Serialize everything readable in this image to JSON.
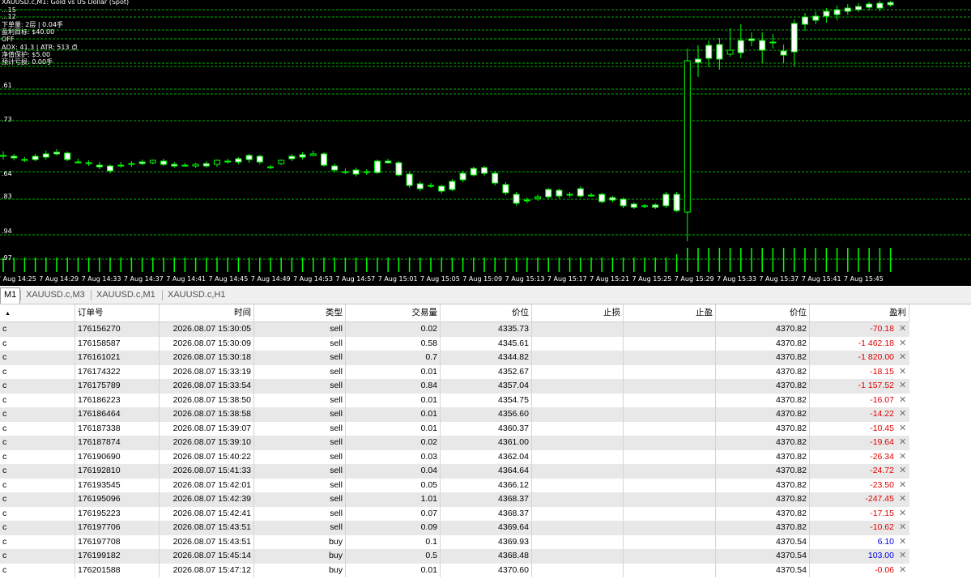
{
  "window_title": "XAUUSD.c,M1: Gold vs US Dollar (Spot)",
  "indicator_lines": [
    "XAUUSD.c,M1: Gold vs US Dollar (Spot)",
    "...15",
    "...12",
    "下单量: 2层 | 0.04手",
    "盈利目标: $40.00",
    "OFF",
    "ADX: 41.3 | ATR: 513 点",
    "净值保护: $5.00",
    "预计亏损: 0.00手"
  ],
  "price_labels": [
    ".61",
    ".73",
    ".64",
    ".83",
    ".94",
    ".97"
  ],
  "time_labels": [
    "7 Aug 14:25",
    "7 Aug 14:29",
    "7 Aug 14:33",
    "7 Aug 14:37",
    "7 Aug 14:41",
    "7 Aug 14:45",
    "7 Aug 14:49",
    "7 Aug 14:53",
    "7 Aug 14:57",
    "7 Aug 15:01",
    "7 Aug 15:05",
    "7 Aug 15:09",
    "7 Aug 15:13",
    "7 Aug 15:17",
    "7 Aug 15:21",
    "7 Aug 15:25",
    "7 Aug 15:29",
    "7 Aug 15:33",
    "7 Aug 15:37",
    "7 Aug 15:41",
    "7 Aug 15:45"
  ],
  "colors": {
    "bull": "#00ff00",
    "bear_body": "#ffffff",
    "grid": "#00b000",
    "background": "#000000",
    "loss": "#e00000",
    "profit": "#0000e0"
  },
  "tabs": [
    {
      "label": "M1",
      "active": true
    },
    {
      "label": "XAUUSD.c,M3",
      "active": false
    },
    {
      "label": "XAUUSD.c,M1",
      "active": false
    },
    {
      "label": "XAUUSD.c,H1",
      "active": false
    }
  ],
  "table": {
    "columns": [
      "",
      "订单号",
      "时间",
      "类型",
      "交易量",
      "价位",
      "止损",
      "止盈",
      "价位",
      "盈利"
    ],
    "rows": [
      {
        "sym": "c",
        "ticket": "176156270",
        "time": "2026.08.07 15:30:05",
        "type": "sell",
        "volume": "0.02",
        "open": "4335.73",
        "sl": "",
        "tp": "",
        "price": "4370.82",
        "profit": "-70.18"
      },
      {
        "sym": "c",
        "ticket": "176158587",
        "time": "2026.08.07 15:30:09",
        "type": "sell",
        "volume": "0.58",
        "open": "4345.61",
        "sl": "",
        "tp": "",
        "price": "4370.82",
        "profit": "-1 462.18"
      },
      {
        "sym": "c",
        "ticket": "176161021",
        "time": "2026.08.07 15:30:18",
        "type": "sell",
        "volume": "0.7",
        "open": "4344.82",
        "sl": "",
        "tp": "",
        "price": "4370.82",
        "profit": "-1 820.00"
      },
      {
        "sym": "c",
        "ticket": "176174322",
        "time": "2026.08.07 15:33:19",
        "type": "sell",
        "volume": "0.01",
        "open": "4352.67",
        "sl": "",
        "tp": "",
        "price": "4370.82",
        "profit": "-18.15"
      },
      {
        "sym": "c",
        "ticket": "176175789",
        "time": "2026.08.07 15:33:54",
        "type": "sell",
        "volume": "0.84",
        "open": "4357.04",
        "sl": "",
        "tp": "",
        "price": "4370.82",
        "profit": "-1 157.52"
      },
      {
        "sym": "c",
        "ticket": "176186223",
        "time": "2026.08.07 15:38:50",
        "type": "sell",
        "volume": "0.01",
        "open": "4354.75",
        "sl": "",
        "tp": "",
        "price": "4370.82",
        "profit": "-16.07"
      },
      {
        "sym": "c",
        "ticket": "176186464",
        "time": "2026.08.07 15:38:58",
        "type": "sell",
        "volume": "0.01",
        "open": "4356.60",
        "sl": "",
        "tp": "",
        "price": "4370.82",
        "profit": "-14.22"
      },
      {
        "sym": "c",
        "ticket": "176187338",
        "time": "2026.08.07 15:39:07",
        "type": "sell",
        "volume": "0.01",
        "open": "4360.37",
        "sl": "",
        "tp": "",
        "price": "4370.82",
        "profit": "-10.45"
      },
      {
        "sym": "c",
        "ticket": "176187874",
        "time": "2026.08.07 15:39:10",
        "type": "sell",
        "volume": "0.02",
        "open": "4361.00",
        "sl": "",
        "tp": "",
        "price": "4370.82",
        "profit": "-19.64"
      },
      {
        "sym": "c",
        "ticket": "176190690",
        "time": "2026.08.07 15:40:22",
        "type": "sell",
        "volume": "0.03",
        "open": "4362.04",
        "sl": "",
        "tp": "",
        "price": "4370.82",
        "profit": "-26.34"
      },
      {
        "sym": "c",
        "ticket": "176192810",
        "time": "2026.08.07 15:41:33",
        "type": "sell",
        "volume": "0.04",
        "open": "4364.64",
        "sl": "",
        "tp": "",
        "price": "4370.82",
        "profit": "-24.72"
      },
      {
        "sym": "c",
        "ticket": "176193545",
        "time": "2026.08.07 15:42:01",
        "type": "sell",
        "volume": "0.05",
        "open": "4366.12",
        "sl": "",
        "tp": "",
        "price": "4370.82",
        "profit": "-23.50"
      },
      {
        "sym": "c",
        "ticket": "176195096",
        "time": "2026.08.07 15:42:39",
        "type": "sell",
        "volume": "1.01",
        "open": "4368.37",
        "sl": "",
        "tp": "",
        "price": "4370.82",
        "profit": "-247.45"
      },
      {
        "sym": "c",
        "ticket": "176195223",
        "time": "2026.08.07 15:42:41",
        "type": "sell",
        "volume": "0.07",
        "open": "4368.37",
        "sl": "",
        "tp": "",
        "price": "4370.82",
        "profit": "-17.15"
      },
      {
        "sym": "c",
        "ticket": "176197706",
        "time": "2026.08.07 15:43:51",
        "type": "sell",
        "volume": "0.09",
        "open": "4369.64",
        "sl": "",
        "tp": "",
        "price": "4370.82",
        "profit": "-10.62"
      },
      {
        "sym": "c",
        "ticket": "176197708",
        "time": "2026.08.07 15:43:51",
        "type": "buy",
        "volume": "0.1",
        "open": "4369.93",
        "sl": "",
        "tp": "",
        "price": "4370.54",
        "profit": "6.10"
      },
      {
        "sym": "c",
        "ticket": "176199182",
        "time": "2026.08.07 15:45:14",
        "type": "buy",
        "volume": "0.5",
        "open": "4368.48",
        "sl": "",
        "tp": "",
        "price": "4370.54",
        "profit": "103.00"
      },
      {
        "sym": "c",
        "ticket": "176201588",
        "time": "2026.08.07 15:47:12",
        "type": "buy",
        "volume": "0.01",
        "open": "4370.60",
        "sl": "",
        "tp": "",
        "price": "4370.54",
        "profit": "-0.06"
      }
    ],
    "close_icon": "close-x-icon"
  }
}
